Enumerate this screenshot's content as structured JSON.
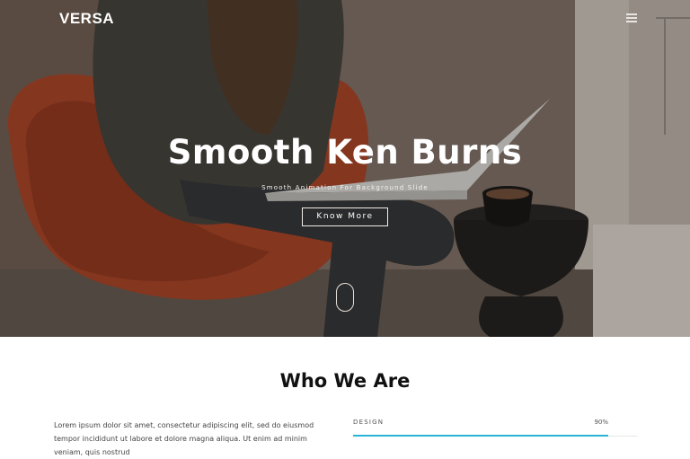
{
  "header": {
    "logo": "VERSA",
    "menu_icon": "hamburger-icon"
  },
  "hero": {
    "title": "Smooth Ken Burns",
    "subtitle": "Smooth Animation For Background Slide",
    "button_label": "Know More",
    "scroll_icon": "mouse-scroll-icon"
  },
  "about": {
    "title": "Who We Are",
    "paragraph": "Lorem ipsum dolor sit amet, consectetur adipiscing elit, sed do eiusmod tempor incididunt ut labore et dolore magna aliqua. Ut enim ad minim veniam, quis nostrud",
    "skills": [
      {
        "label": "DESIGN",
        "percent_label": "90%",
        "percent": 90
      }
    ]
  },
  "colors": {
    "accent": "#27b3d6",
    "chair": "#a33e22"
  }
}
